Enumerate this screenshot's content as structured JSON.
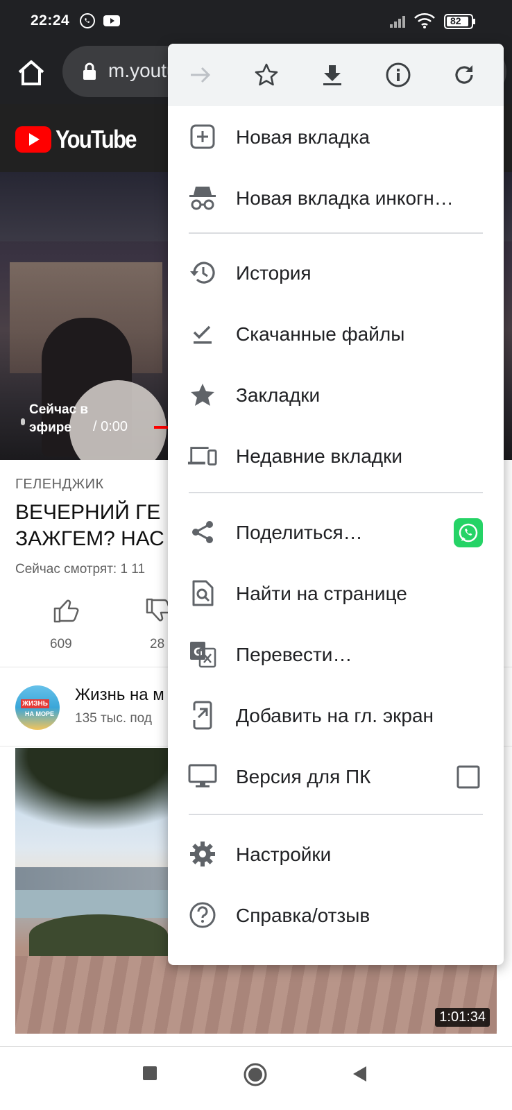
{
  "status_bar": {
    "time": "22:24",
    "battery": "82",
    "icons": [
      "whatsapp-icon",
      "youtube-icon",
      "signal-icon",
      "wifi-icon",
      "battery-icon"
    ]
  },
  "browser": {
    "url": "m.youtube.com"
  },
  "youtube": {
    "logo_text": "YouTube",
    "player": {
      "live_label": "Сейчас в эфире",
      "time": "/ 0:00"
    },
    "video": {
      "location_tag": "ГЕЛЕНДЖИК",
      "title": "ВЕЧЕРНИЙ ГЕ ЗАЖГЕМ? НАС",
      "viewers": "Сейчас смотрят: 1 11",
      "likes": "609",
      "dislikes": "28"
    },
    "channel": {
      "name": "Жизнь на м",
      "subscribers": "135 тыс. под",
      "avatar_text_1": "ЖИЗНЬ",
      "avatar_text_2": "НА МОРЕ"
    },
    "next_video": {
      "duration": "1:01:34"
    }
  },
  "menu": {
    "actions": [
      "forward-icon",
      "bookmark-star-icon",
      "download-icon",
      "info-icon",
      "reload-icon"
    ],
    "items": [
      {
        "label": "Новая вкладка",
        "icon": "new-tab-icon"
      },
      {
        "label": "Новая вкладка инкогн…",
        "icon": "incognito-icon"
      },
      {
        "label": "История",
        "icon": "history-icon"
      },
      {
        "label": "Скачанные файлы",
        "icon": "downloads-icon"
      },
      {
        "label": "Закладки",
        "icon": "bookmarks-icon"
      },
      {
        "label": "Недавние вкладки",
        "icon": "recent-tabs-icon"
      },
      {
        "label": "Поделиться…",
        "icon": "share-icon"
      },
      {
        "label": "Найти на странице",
        "icon": "find-in-page-icon"
      },
      {
        "label": "Перевести…",
        "icon": "translate-icon"
      },
      {
        "label": "Добавить на гл. экран",
        "icon": "add-to-home-icon"
      },
      {
        "label": "Версия для ПК",
        "icon": "desktop-icon"
      },
      {
        "label": "Настройки",
        "icon": "settings-icon"
      },
      {
        "label": "Справка/отзыв",
        "icon": "help-icon"
      }
    ],
    "desktop_version_checked": false
  },
  "colors": {
    "menu_bg": "#ffffff",
    "action_row_bg": "#f1f3f4",
    "youtube_red": "#ff0000",
    "whatsapp_green": "#25d366"
  }
}
